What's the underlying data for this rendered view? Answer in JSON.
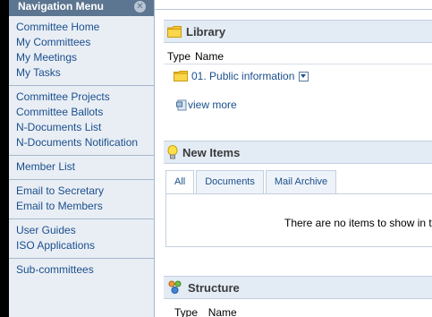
{
  "sidebar": {
    "title": "Navigation Menu",
    "groups": [
      {
        "items": [
          "Committee Home",
          "My Committees",
          "My Meetings",
          "My Tasks"
        ]
      },
      {
        "items": [
          "Committee Projects",
          "Committee Ballots",
          "N-Documents List",
          "N-Documents Notification"
        ]
      },
      {
        "items": [
          "Member List"
        ]
      },
      {
        "items": [
          "Email to Secretary",
          "Email to Members"
        ]
      },
      {
        "items": [
          "User Guides",
          "ISO Applications"
        ]
      },
      {
        "items": [
          "Sub-committees"
        ]
      }
    ]
  },
  "library": {
    "title": "Library",
    "col_type": "Type",
    "col_name": "Name",
    "folder": "01. Public information",
    "view_more": "view more"
  },
  "new_items": {
    "title": "New Items",
    "tabs": [
      "All",
      "Documents",
      "Mail Archive"
    ],
    "empty_message": "There are no items to show in th"
  },
  "structure": {
    "title": "Structure",
    "col_type": "Type",
    "col_name": "Name"
  },
  "colors": {
    "nav_header": "#5c7590",
    "link": "#1b4f8c",
    "panel_header": "#e3ebf5"
  }
}
